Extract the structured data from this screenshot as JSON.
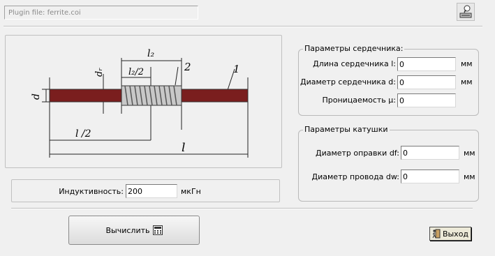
{
  "header": {
    "plugin_file": "Plugin file: ferrite.coi"
  },
  "diagram": {
    "label_l2": "l₂",
    "label_l2_half": "l₂/2",
    "label_df": "dᵣ",
    "label_d": "d",
    "label_2": "2",
    "label_1": "1",
    "label_l_half": "l /2",
    "label_l": "l"
  },
  "core": {
    "title": "Параметры сердечника:",
    "length_label": "Длина сердечника l:",
    "length_value": "0",
    "length_unit": "мм",
    "diameter_label": "Диаметр сердечника d:",
    "diameter_value": "0",
    "diameter_unit": "мм",
    "permeability_label": "Проницаемость μ:",
    "permeability_value": "0"
  },
  "coil": {
    "title": "Параметры катушки",
    "mandrel_label": "Диаметр оправки df:",
    "mandrel_value": "0",
    "mandrel_unit": "мм",
    "wire_label": "Диаметр провода dw:",
    "wire_value": "0",
    "wire_unit": "мм"
  },
  "result": {
    "label": "Индуктивность:",
    "value": "200",
    "unit": "мкГн"
  },
  "buttons": {
    "calculate": "Вычислить",
    "exit": "Выход"
  }
}
